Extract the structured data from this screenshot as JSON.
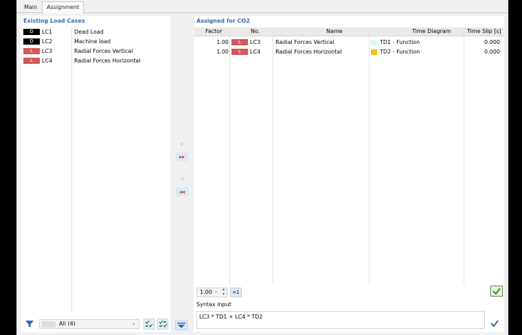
{
  "tabs": [
    {
      "label": "Main"
    },
    {
      "label": "Assignment"
    }
  ],
  "left": {
    "title": "Existing Load Cases",
    "rows": [
      {
        "type": "D",
        "lc": "LC1",
        "name": "Dead Load"
      },
      {
        "type": "D",
        "lc": "LC2",
        "name": "Machine load"
      },
      {
        "type": "L",
        "lc": "LC3",
        "name": "Radial Forces Vertical"
      },
      {
        "type": "L",
        "lc": "LC4",
        "name": "Radial Forces Horizontal"
      }
    ],
    "filter": {
      "value": "All (4)"
    }
  },
  "middle": {
    "arrows": [
      "▸",
      "▸▸",
      "◂",
      "◂◂"
    ]
  },
  "right": {
    "title": "Assigned for CO2",
    "columns": [
      "Factor",
      "No.",
      "Name",
      "Time Diagram",
      "Time Slip [s]"
    ],
    "rows": [
      {
        "factor": "1.00",
        "type": "L",
        "no": "LC3",
        "name": "Radial Forces Vertical",
        "td_color": "#d6f3f8",
        "td": "TD1 - Function",
        "slip": "0.000"
      },
      {
        "factor": "1.00",
        "type": "L",
        "no": "LC4",
        "name": "Radial Forces Horizontal",
        "td_color": "#f0c01c",
        "td": "TD2 - Function",
        "slip": "0.000"
      }
    ],
    "factor_spinner": {
      "value": "1.00"
    },
    "eq1_label": "=1",
    "syntax_label": "Syntax input",
    "syntax_value": "LC3 * TD1 + LC4 * TD2"
  },
  "colors": {
    "accent_title": "#2e6cb0",
    "load_badge": "#d45759",
    "dead_badge": "#000000"
  }
}
